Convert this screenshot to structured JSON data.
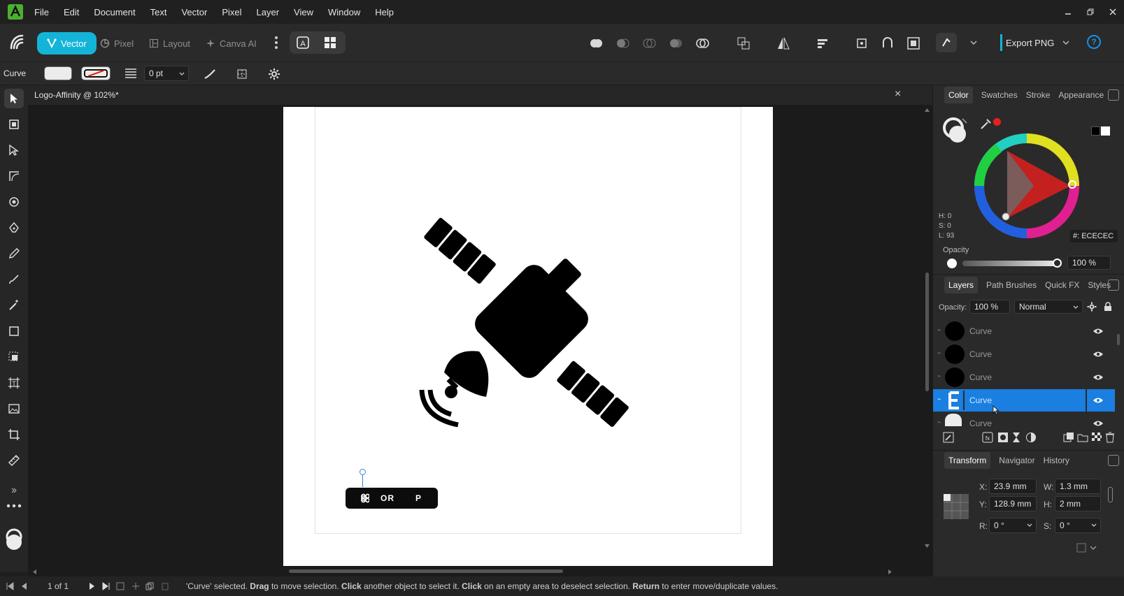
{
  "menubar": {
    "items": [
      "File",
      "Edit",
      "Document",
      "Text",
      "Vector",
      "Pixel",
      "Layer",
      "View",
      "Window",
      "Help"
    ]
  },
  "toolbar": {
    "personas": [
      "Vector",
      "Pixel",
      "Layout",
      "Canva AI"
    ],
    "export_label": "Export PNG",
    "help_label": "?"
  },
  "context": {
    "tool_label": "Curve",
    "stroke_width": "0 pt"
  },
  "document": {
    "tab_title": "Logo-Affinity @ 102%*",
    "close_label": "×",
    "shortcut_badge": {
      "key1": "OR",
      "key2": "P"
    }
  },
  "color_panel": {
    "tabs": [
      "Color",
      "Swatches",
      "Stroke",
      "Appearance"
    ],
    "hsl": [
      "H: 0",
      "S: 0",
      "L: 93"
    ],
    "hex": "ECECEC",
    "hex_prefix": "#:",
    "opacity_label": "Opacity",
    "opacity_value": "100 %",
    "accent_color": "#e32020"
  },
  "layers_panel": {
    "tabs": [
      "Layers",
      "Path Brushes",
      "Quick FX",
      "Styles"
    ],
    "opacity_label": "Opacity:",
    "opacity_value": "100 %",
    "blend_mode": "Normal",
    "layers": [
      {
        "name": "Curve",
        "selected": false
      },
      {
        "name": "Curve",
        "selected": false
      },
      {
        "name": "Curve",
        "selected": false
      },
      {
        "name": "Curve",
        "selected": true
      },
      {
        "name": "Curve",
        "selected": false
      }
    ],
    "selected_color": "#1a7fe0"
  },
  "transform_panel": {
    "tabs": [
      "Transform",
      "Navigator",
      "History"
    ],
    "labels": {
      "x": "X:",
      "y": "Y:",
      "w": "W:",
      "h": "H:",
      "r": "R:",
      "s": "S:"
    },
    "x": "23.9 mm",
    "y": "128.9 mm",
    "w": "1.3 mm",
    "h": "2 mm",
    "r": "0 °",
    "s": "0 °"
  },
  "statusbar": {
    "page": "1 of 1",
    "message_parts": [
      "'Curve' selected. ",
      "Drag",
      " to move selection. ",
      "Click",
      " another object to select it. ",
      "Click",
      " on an empty area to deselect selection. ",
      "Return",
      " to enter move/duplicate values."
    ]
  },
  "colors": {
    "accent": "#14b4d8",
    "selection": "#1a7fe0"
  }
}
